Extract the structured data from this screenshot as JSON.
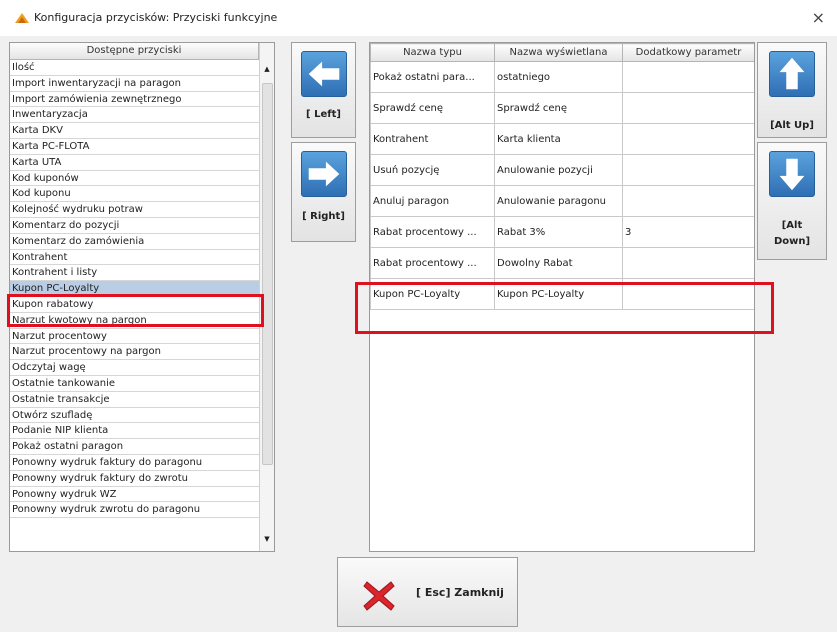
{
  "window": {
    "title": "Konfiguracja przycisków: Przyciski funkcyjne",
    "close_glyph": "×"
  },
  "available_list": {
    "header": "Dostępne przyciski",
    "items": [
      "Ilość",
      "Import inwentaryzacji na paragon",
      "Import zamówienia zewnętrznego",
      "Inwentaryzacja",
      "Karta DKV",
      "Karta PC-FLOTA",
      "Karta UTA",
      "Kod kuponów",
      "Kod kuponu",
      "Kolejność wydruku potraw",
      "Komentarz do pozycji",
      "Komentarz do zamówienia",
      "Kontrahent",
      "Kontrahent i listy",
      "Kupon PC-Loyalty",
      "Kupon rabatowy",
      "Narzut kwotowy na pargon",
      "Narzut procentowy",
      "Narzut procentowy na pargon",
      "Odczytaj wagę",
      "Ostatnie tankowanie",
      "Ostatnie transakcje",
      "Otwórz szufladę",
      "Podanie NIP klienta",
      "Pokaż ostatni paragon",
      "Ponowny wydruk faktury do paragonu",
      "Ponowny wydruk faktury do zwrotu",
      "Ponowny wydruk WZ",
      "Ponowny wydruk zwrotu do paragonu"
    ],
    "selected_index": 14
  },
  "move_buttons": {
    "left_label": "[ Left]",
    "right_label": "[ Right]"
  },
  "order_buttons": {
    "up_label": "[Alt Up]",
    "down_label_1": "[Alt",
    "down_label_2": "Down]"
  },
  "table": {
    "columns": [
      "Nazwa typu",
      "Nazwa wyświetlana",
      "Dodatkowy parametr"
    ],
    "rows": [
      {
        "type": "Pokaż ostatni para...",
        "display": "ostatniego",
        "param": ""
      },
      {
        "type": "Sprawdź cenę",
        "display": "Sprawdź cenę",
        "param": ""
      },
      {
        "type": "Kontrahent",
        "display": "Karta klienta",
        "param": ""
      },
      {
        "type": "Usuń pozycję",
        "display": "Anulowanie pozycji",
        "param": ""
      },
      {
        "type": "Anuluj paragon",
        "display": "Anulowanie paragonu",
        "param": ""
      },
      {
        "type": "Rabat procentowy ...",
        "display": "Rabat 3%",
        "param": "3"
      },
      {
        "type": "Rabat procentowy ...",
        "display": "Dowolny Rabat",
        "param": ""
      },
      {
        "type": "Kupon PC-Loyalty",
        "display": "Kupon PC-Loyalty",
        "param": ""
      }
    ]
  },
  "footer": {
    "close_label": "[ Esc] Zamknij"
  },
  "colors": {
    "highlight_red": "#e0111f",
    "selection_blue": "#b9cde5",
    "arrow_blue": "#2f6fb4",
    "close_x_red": "#d9262d"
  },
  "icons": [
    "logo-icon",
    "close-icon",
    "arrow-left-icon",
    "arrow-right-icon",
    "arrow-up-icon",
    "arrow-down-icon",
    "red-x-icon"
  ]
}
